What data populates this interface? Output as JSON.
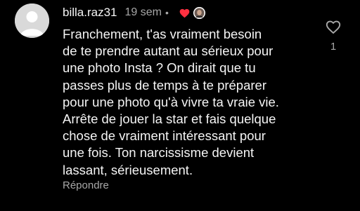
{
  "comment": {
    "username": "billa.raz31",
    "timestamp": "19 sem",
    "separator": "•",
    "text": "Franchement, t'as vraiment besoin\nde te prendre autant au sérieux pour\nune photo Insta ? On dirait que tu\npasses plus de temps à te préparer\npour une photo qu'à vivre ta vraie vie.\nArrête de jouer la star et fais quelque\nchose de vraiment intéressant pour\nune fois. Ton narcissisme devient\nlassant, sérieusement.",
    "reply_label": "Répondre",
    "like_count": "1",
    "creator_liked": true
  },
  "icons": {
    "avatar": "default-avatar-icon",
    "creator_heart": "heart-filled-icon",
    "creator_avatar": "creator-avatar",
    "like": "heart-outline-icon"
  },
  "colors": {
    "background": "#000000",
    "primary_text": "#f5f5f5",
    "secondary_text": "#a8a8a8",
    "heart_red": "#ff3040",
    "avatar_placeholder": "#d9d9d9"
  }
}
